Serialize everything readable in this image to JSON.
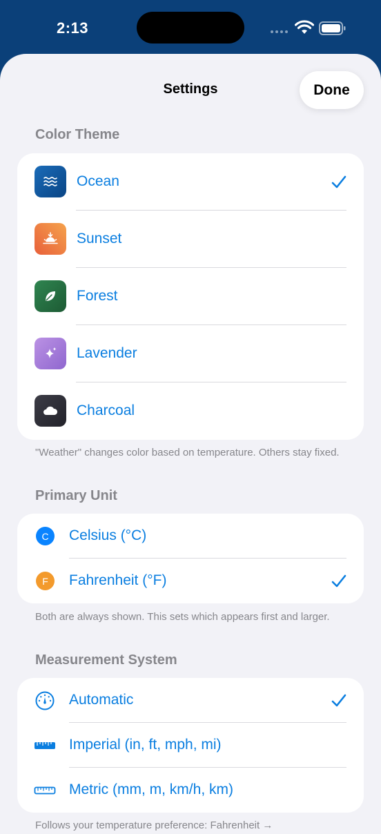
{
  "status_bar": {
    "time": "2:13"
  },
  "nav": {
    "title": "Settings",
    "done_label": "Done"
  },
  "color_theme": {
    "header": "Color Theme",
    "items": [
      {
        "label": "Ocean",
        "icon": "waves-icon",
        "color_from": "#1a5ea8",
        "color_to": "#0a4a8a",
        "selected": true
      },
      {
        "label": "Sunset",
        "icon": "sunset-icon",
        "color_from": "#f5a04a",
        "color_to": "#e8693a",
        "selected": false
      },
      {
        "label": "Forest",
        "icon": "leaf-icon",
        "color_from": "#2e7d4a",
        "color_to": "#1f5d36",
        "selected": false
      },
      {
        "label": "Lavender",
        "icon": "sparkle-icon",
        "color_from": "#b58be0",
        "color_to": "#9168cf",
        "selected": false
      },
      {
        "label": "Charcoal",
        "icon": "cloud-icon",
        "color_from": "#3a3a44",
        "color_to": "#22222a",
        "selected": false
      }
    ],
    "footer": "\"Weather\" changes color based on temperature. Others stay fixed."
  },
  "primary_unit": {
    "header": "Primary Unit",
    "items": [
      {
        "label": "Celsius (°C)",
        "badge": "C",
        "badge_color": "#0a84ff",
        "selected": false
      },
      {
        "label": "Fahrenheit (°F)",
        "badge": "F",
        "badge_color": "#f39a2c",
        "selected": true
      }
    ],
    "footer": "Both are always shown. This sets which appears first and larger."
  },
  "measurement_system": {
    "header": "Measurement System",
    "items": [
      {
        "label": "Automatic",
        "icon": "gauge-icon",
        "selected": true
      },
      {
        "label": "Imperial (in, ft, mph, mi)",
        "icon": "ruler-icon",
        "selected": false
      },
      {
        "label": "Metric (mm, m, km/h, km)",
        "icon": "ruler-icon",
        "selected": false
      }
    ],
    "footer": "Follows your temperature preference: Fahrenheit →"
  },
  "colors": {
    "accent": "#0a7ee0",
    "background": "#f2f2f7",
    "header_text": "#86868b",
    "backdrop": "#0b4079"
  }
}
